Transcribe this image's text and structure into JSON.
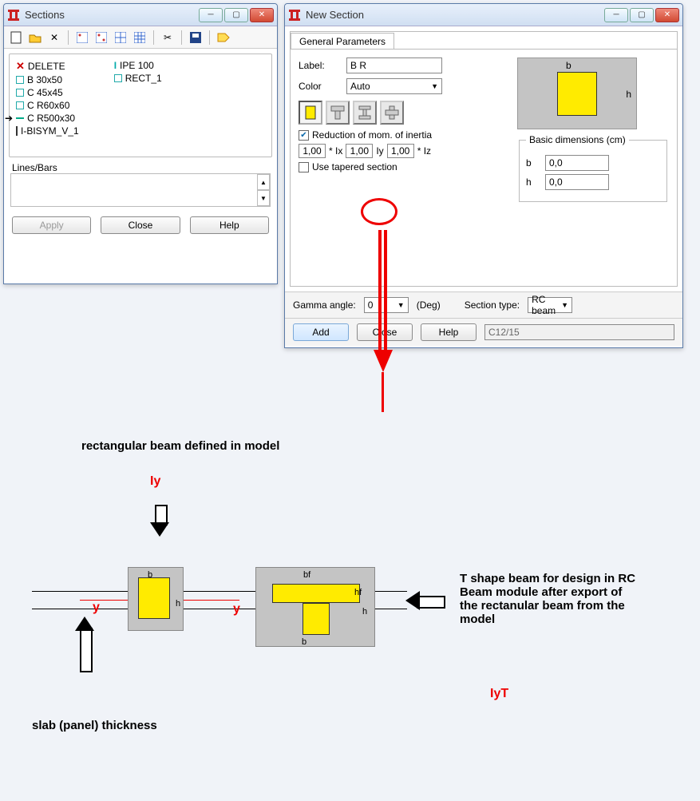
{
  "sections_window": {
    "title": "Sections",
    "list_left": [
      {
        "icon": "x",
        "label": "DELETE"
      },
      {
        "icon": "rect",
        "label": "B 30x50"
      },
      {
        "icon": "rect",
        "label": "C 45x45"
      },
      {
        "icon": "rect",
        "label": "C R60x60"
      },
      {
        "icon": "dash",
        "label": "C R500x30",
        "selected": true
      },
      {
        "icon": "bar",
        "label": "I-BISYM_V_1"
      }
    ],
    "list_right": [
      {
        "icon": "i",
        "label": "IPE 100"
      },
      {
        "icon": "rect",
        "label": "RECT_1"
      }
    ],
    "lines_bars_label": "Lines/Bars",
    "buttons": {
      "apply": "Apply",
      "close": "Close",
      "help": "Help"
    }
  },
  "newsection_window": {
    "title": "New Section",
    "tab": "General Parameters",
    "label_label": "Label:",
    "label_value": "B R",
    "color_label": "Color",
    "color_value": "Auto",
    "preview": {
      "b": "b",
      "h": "h"
    },
    "shapes": [
      "rect",
      "tee",
      "ibeam",
      "cross"
    ],
    "reduction_label": "Reduction of mom. of inertia",
    "reduction_checked": true,
    "ix": "1,00",
    "ix_suffix": "* Ix",
    "iy": "1,00",
    "iy_suffix": "Iy",
    "iz": "1,00",
    "iz_suffix": "* Iz",
    "tapered_label": "Use tapered section",
    "tapered_checked": false,
    "dimensions": {
      "legend": "Basic dimensions (cm)",
      "b_label": "b",
      "b_value": "0,0",
      "h_label": "h",
      "h_value": "0,0"
    },
    "gamma_label": "Gamma angle:",
    "gamma_value": "0",
    "gamma_unit": "(Deg)",
    "section_type_label": "Section type:",
    "section_type_value": "RC beam",
    "buttons": {
      "add": "Add",
      "close": "Close",
      "help": "Help"
    },
    "material": "C12/15"
  },
  "diagram": {
    "rect_beam_label": "rectangular beam defined in model",
    "iy": "Iy",
    "y1": "y",
    "y2": "y",
    "b": "b",
    "h": "h",
    "bf": "bf",
    "hf": "hf",
    "tshape_text": "T shape beam for design in RC Beam module after export of the rectanular beam from the model",
    "iyt": "IyT",
    "slab_text": "slab (panel) thickness"
  }
}
